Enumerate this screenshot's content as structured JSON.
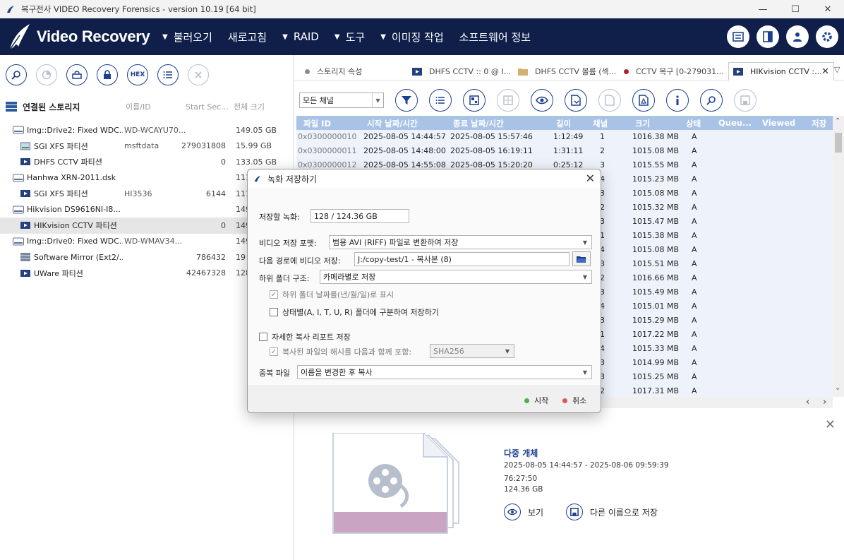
{
  "window": {
    "title": "복구전사 VIDEO Recovery Forensics - version 10.19 [64 bit]",
    "minimize": "—",
    "maximize": "☐",
    "close": "✕"
  },
  "header": {
    "logo_text": "Video Recovery",
    "menu": [
      {
        "label": "불러오기",
        "has_arrow": true
      },
      {
        "label": "새로고침",
        "has_arrow": false
      },
      {
        "label": "RAID",
        "has_arrow": true
      },
      {
        "label": "도구",
        "has_arrow": true
      },
      {
        "label": "이미징 작업",
        "has_arrow": true
      },
      {
        "label": "소프트웨어 정보",
        "has_arrow": false
      }
    ],
    "icons": [
      "list-panel-icon",
      "layout-icon",
      "user-icon",
      "gear-icon"
    ]
  },
  "left_toolbar": [
    "search-icon",
    "chart-icon",
    "refresh-drive-icon",
    "lock-icon",
    "HEX",
    "list-icon",
    "close-icon"
  ],
  "storage": {
    "title": "연결된 스토리지",
    "col_id": "이름/ID",
    "col_start": "Start Sec...",
    "col_size": "전체 크기",
    "items": [
      {
        "name": "Img::Drive2: Fixed WDC...",
        "id": "WD-WCAYU70...",
        "start": "",
        "size": "149.05 GB",
        "level": 0,
        "icon": "hdd"
      },
      {
        "name": "SGI XFS 파티션",
        "id": "msftdata",
        "start": "279031808",
        "size": "15.99 GB",
        "level": 1,
        "icon": "partition-gray"
      },
      {
        "name": "DHFS CCTV 파티션",
        "id": "",
        "start": "0",
        "size": "133.05 GB",
        "level": 1,
        "icon": "partition-blue"
      },
      {
        "name": "Hanhwa XRN-2011.dsk",
        "id": "",
        "start": "",
        "size": "111",
        "level": 0,
        "icon": "hdd"
      },
      {
        "name": "SGI XFS 파티션",
        "id": "HI3536",
        "start": "6144",
        "size": "111",
        "level": 1,
        "icon": "partition-blue"
      },
      {
        "name": "Hikvision DS9616NI-I8...",
        "id": "",
        "start": "",
        "size": "149",
        "level": 0,
        "icon": "hdd"
      },
      {
        "name": "HIKvision CCTV 파티션",
        "id": "",
        "start": "0",
        "size": "149",
        "level": 1,
        "icon": "partition-blue",
        "selected": true
      },
      {
        "name": "Img::Drive0: Fixed WDC...",
        "id": "WD-WMAV34...",
        "start": "",
        "size": "149",
        "level": 0,
        "icon": "hdd"
      },
      {
        "name": "Software Mirror (Ext2/...",
        "id": "",
        "start": "786432",
        "size": "19",
        "level": 1,
        "icon": "raid"
      },
      {
        "name": "UWare 파티션",
        "id": "",
        "start": "42467328",
        "size": "128",
        "level": 1,
        "icon": "partition-blue"
      }
    ]
  },
  "tabs": [
    {
      "label": "스토리지 속성",
      "icon": "dot-gray"
    },
    {
      "label": "DHFS CCTV :: 0 @ I...",
      "icon": "video"
    },
    {
      "label": "DHFS CCTV 볼륨 (섹...",
      "icon": "folder"
    },
    {
      "label": "CCTV 복구 [0-279031...",
      "icon": "dot-red"
    },
    {
      "label": "HIKvision CCTV :...",
      "icon": "video",
      "active": true
    }
  ],
  "tab_close": "✕",
  "tab_menu": "▽",
  "right_toolbar": {
    "channel_select": "모든 채널",
    "icons": [
      "filter-icon",
      "list-icon",
      "grid-icon",
      "thumbnails-icon",
      "eye-icon",
      "export-icon",
      "export-disabled-icon",
      "report-icon",
      "info-icon",
      "search-icon",
      "save-icon"
    ]
  },
  "table": {
    "columns": [
      "파일 ID",
      "시작 날짜/시간",
      "종료 날짜/시간",
      "길이",
      "채널",
      "크기",
      "상태",
      "Queu...",
      "Viewed",
      "저장"
    ],
    "rows": [
      {
        "id": "0x0300000010",
        "start": "2025-08-05 14:44:57",
        "end": "2025-08-05 15:57:46",
        "len": "1:12:49",
        "ch": "1",
        "size": "1016.38 MB",
        "st": "A"
      },
      {
        "id": "0x0300000011",
        "start": "2025-08-05 14:48:00",
        "end": "2025-08-05 16:19:11",
        "len": "1:31:11",
        "ch": "2",
        "size": "1015.08 MB",
        "st": "A"
      },
      {
        "id": "0x0300000012",
        "start": "2025-08-05 14:55:08",
        "end": "2025-08-05 15:20:20",
        "len": "0:25:12",
        "ch": "3",
        "size": "1015.55 MB",
        "st": "A"
      },
      {
        "id": "",
        "start": "",
        "end": "",
        "len": "",
        "ch": "4",
        "size": "1015.23 MB",
        "st": "A"
      },
      {
        "id": "",
        "start": "",
        "end": "",
        "len": "",
        "ch": "3",
        "size": "1015.08 MB",
        "st": "A"
      },
      {
        "id": "",
        "start": "",
        "end": "",
        "len": "",
        "ch": "2",
        "size": "1015.32 MB",
        "st": "A"
      },
      {
        "id": "",
        "start": "",
        "end": "",
        "len": "",
        "ch": "3",
        "size": "1015.47 MB",
        "st": "A"
      },
      {
        "id": "",
        "start": "",
        "end": "",
        "len": "",
        "ch": "1",
        "size": "1015.38 MB",
        "st": "A"
      },
      {
        "id": "",
        "start": "",
        "end": "",
        "len": "",
        "ch": "4",
        "size": "1015.08 MB",
        "st": "A"
      },
      {
        "id": "",
        "start": "",
        "end": "",
        "len": "",
        "ch": "3",
        "size": "1015.51 MB",
        "st": "A"
      },
      {
        "id": "",
        "start": "",
        "end": "",
        "len": "",
        "ch": "2",
        "size": "1016.66 MB",
        "st": "A"
      },
      {
        "id": "",
        "start": "",
        "end": "",
        "len": "",
        "ch": "3",
        "size": "1015.49 MB",
        "st": "A"
      },
      {
        "id": "",
        "start": "",
        "end": "",
        "len": "",
        "ch": "4",
        "size": "1015.01 MB",
        "st": "A"
      },
      {
        "id": "",
        "start": "",
        "end": "",
        "len": "",
        "ch": "3",
        "size": "1015.29 MB",
        "st": "A"
      },
      {
        "id": "",
        "start": "",
        "end": "",
        "len": "",
        "ch": "1",
        "size": "1017.22 MB",
        "st": "A"
      },
      {
        "id": "",
        "start": "",
        "end": "",
        "len": "",
        "ch": "4",
        "size": "1015.33 MB",
        "st": "A"
      },
      {
        "id": "",
        "start": "",
        "end": "",
        "len": "",
        "ch": "3",
        "size": "1014.99 MB",
        "st": "A"
      },
      {
        "id": "",
        "start": "",
        "end": "",
        "len": "",
        "ch": "3",
        "size": "1015.25 MB",
        "st": "A"
      },
      {
        "id": "",
        "start": "",
        "end": "",
        "len": "",
        "ch": "2",
        "size": "1017.31 MB",
        "st": "A"
      }
    ],
    "scroll_left": "‹",
    "scroll_right": "›",
    "scroll_up": "⌃",
    "scroll_down": "⌄"
  },
  "preview": {
    "title": "다중 개체",
    "range": "2025-08-05 14:44:57 - 2025-08-06 09:59:39",
    "duration": "76:27:50",
    "size": "124.36 GB",
    "view_label": "보기",
    "save_as_label": "다른 이름으로 저장",
    "close": "✕"
  },
  "dialog": {
    "title": "녹화 저장하기",
    "close": "✕",
    "recordings_label": "저장할 녹화:",
    "recordings_value": "128 / 124.36 GB",
    "format_label": "비디오 저장 포맷:",
    "format_value": "범용 AVI (RIFF) 파일로 변환하여 저장",
    "path_label": "다음 경로에 비디오 저장:",
    "path_value": "J:/copy-test/1 - 복사본 (8)",
    "subfolder_label": "하위 폴더 구조:",
    "subfolder_value": "카메라별로 저장",
    "chk_date_folder": "하위 폴더 날짜를(년/월/일)로 표시",
    "chk_status_folder": "상태별(A, I, T, U, R) 폴더에 구분하여 저장하기",
    "chk_report": "자세한 복사 리포트 저장",
    "chk_hash": "복사된 파일의 해시를 다음과 함께 포함:",
    "hash_value": "SHA256",
    "dup_label": "중복 파일",
    "dup_value": "이름을 변경한 후 복사",
    "start_label": "시작",
    "cancel_label": "취소",
    "start_color": "#4caf50",
    "cancel_color": "#e05555"
  }
}
